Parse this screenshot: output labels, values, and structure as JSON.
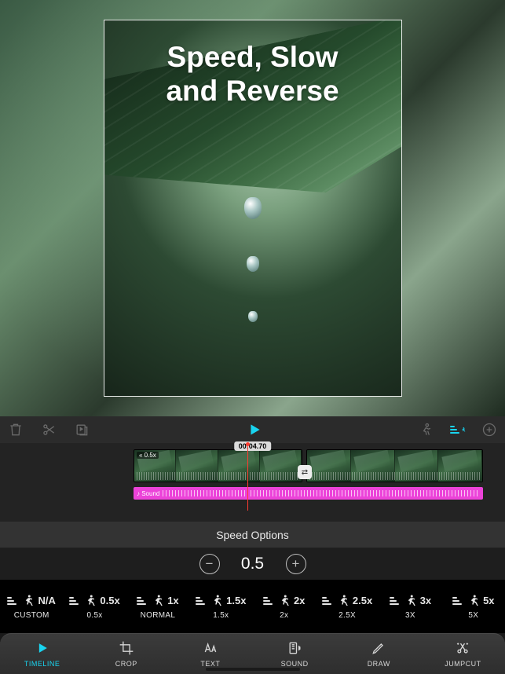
{
  "overlay": {
    "title_line1": "Speed, Slow",
    "title_line2": "and Reverse"
  },
  "toolbar": {
    "timecode": "00:04.70"
  },
  "clip": {
    "badge": "« 0.5x"
  },
  "audio": {
    "label": "♪ Sound"
  },
  "transition": {
    "glyph": "⇄"
  },
  "panel": {
    "title": "Speed Options"
  },
  "speed": {
    "value": "0.5",
    "minus": "−",
    "plus": "+"
  },
  "presets": [
    {
      "mult": "N/A",
      "label": "CUSTOM"
    },
    {
      "mult": "0.5x",
      "label": "0.5x"
    },
    {
      "mult": "1x",
      "label": "NORMAL"
    },
    {
      "mult": "1.5x",
      "label": "1.5x"
    },
    {
      "mult": "2x",
      "label": "2x"
    },
    {
      "mult": "2.5x",
      "label": "2.5X"
    },
    {
      "mult": "3x",
      "label": "3X"
    },
    {
      "mult": "5x",
      "label": "5X"
    }
  ],
  "tabs": [
    {
      "label": "TIMELINE"
    },
    {
      "label": "CROP"
    },
    {
      "label": "TEXT"
    },
    {
      "label": "SOUND"
    },
    {
      "label": "DRAW"
    },
    {
      "label": "JUMPCUT"
    }
  ]
}
